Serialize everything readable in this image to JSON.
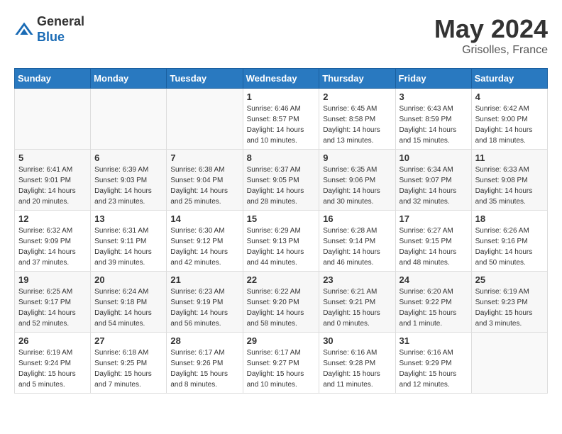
{
  "header": {
    "logo_general": "General",
    "logo_blue": "Blue",
    "title": "May 2024",
    "location": "Grisolles, France"
  },
  "calendar": {
    "weekdays": [
      "Sunday",
      "Monday",
      "Tuesday",
      "Wednesday",
      "Thursday",
      "Friday",
      "Saturday"
    ],
    "weeks": [
      [
        {
          "day": "",
          "sunrise": "",
          "sunset": "",
          "daylight": ""
        },
        {
          "day": "",
          "sunrise": "",
          "sunset": "",
          "daylight": ""
        },
        {
          "day": "",
          "sunrise": "",
          "sunset": "",
          "daylight": ""
        },
        {
          "day": "1",
          "sunrise": "6:46 AM",
          "sunset": "8:57 PM",
          "daylight": "14 hours and 10 minutes."
        },
        {
          "day": "2",
          "sunrise": "6:45 AM",
          "sunset": "8:58 PM",
          "daylight": "14 hours and 13 minutes."
        },
        {
          "day": "3",
          "sunrise": "6:43 AM",
          "sunset": "8:59 PM",
          "daylight": "14 hours and 15 minutes."
        },
        {
          "day": "4",
          "sunrise": "6:42 AM",
          "sunset": "9:00 PM",
          "daylight": "14 hours and 18 minutes."
        }
      ],
      [
        {
          "day": "5",
          "sunrise": "6:41 AM",
          "sunset": "9:01 PM",
          "daylight": "14 hours and 20 minutes."
        },
        {
          "day": "6",
          "sunrise": "6:39 AM",
          "sunset": "9:03 PM",
          "daylight": "14 hours and 23 minutes."
        },
        {
          "day": "7",
          "sunrise": "6:38 AM",
          "sunset": "9:04 PM",
          "daylight": "14 hours and 25 minutes."
        },
        {
          "day": "8",
          "sunrise": "6:37 AM",
          "sunset": "9:05 PM",
          "daylight": "14 hours and 28 minutes."
        },
        {
          "day": "9",
          "sunrise": "6:35 AM",
          "sunset": "9:06 PM",
          "daylight": "14 hours and 30 minutes."
        },
        {
          "day": "10",
          "sunrise": "6:34 AM",
          "sunset": "9:07 PM",
          "daylight": "14 hours and 32 minutes."
        },
        {
          "day": "11",
          "sunrise": "6:33 AM",
          "sunset": "9:08 PM",
          "daylight": "14 hours and 35 minutes."
        }
      ],
      [
        {
          "day": "12",
          "sunrise": "6:32 AM",
          "sunset": "9:09 PM",
          "daylight": "14 hours and 37 minutes."
        },
        {
          "day": "13",
          "sunrise": "6:31 AM",
          "sunset": "9:11 PM",
          "daylight": "14 hours and 39 minutes."
        },
        {
          "day": "14",
          "sunrise": "6:30 AM",
          "sunset": "9:12 PM",
          "daylight": "14 hours and 42 minutes."
        },
        {
          "day": "15",
          "sunrise": "6:29 AM",
          "sunset": "9:13 PM",
          "daylight": "14 hours and 44 minutes."
        },
        {
          "day": "16",
          "sunrise": "6:28 AM",
          "sunset": "9:14 PM",
          "daylight": "14 hours and 46 minutes."
        },
        {
          "day": "17",
          "sunrise": "6:27 AM",
          "sunset": "9:15 PM",
          "daylight": "14 hours and 48 minutes."
        },
        {
          "day": "18",
          "sunrise": "6:26 AM",
          "sunset": "9:16 PM",
          "daylight": "14 hours and 50 minutes."
        }
      ],
      [
        {
          "day": "19",
          "sunrise": "6:25 AM",
          "sunset": "9:17 PM",
          "daylight": "14 hours and 52 minutes."
        },
        {
          "day": "20",
          "sunrise": "6:24 AM",
          "sunset": "9:18 PM",
          "daylight": "14 hours and 54 minutes."
        },
        {
          "day": "21",
          "sunrise": "6:23 AM",
          "sunset": "9:19 PM",
          "daylight": "14 hours and 56 minutes."
        },
        {
          "day": "22",
          "sunrise": "6:22 AM",
          "sunset": "9:20 PM",
          "daylight": "14 hours and 58 minutes."
        },
        {
          "day": "23",
          "sunrise": "6:21 AM",
          "sunset": "9:21 PM",
          "daylight": "15 hours and 0 minutes."
        },
        {
          "day": "24",
          "sunrise": "6:20 AM",
          "sunset": "9:22 PM",
          "daylight": "15 hours and 1 minute."
        },
        {
          "day": "25",
          "sunrise": "6:19 AM",
          "sunset": "9:23 PM",
          "daylight": "15 hours and 3 minutes."
        }
      ],
      [
        {
          "day": "26",
          "sunrise": "6:19 AM",
          "sunset": "9:24 PM",
          "daylight": "15 hours and 5 minutes."
        },
        {
          "day": "27",
          "sunrise": "6:18 AM",
          "sunset": "9:25 PM",
          "daylight": "15 hours and 7 minutes."
        },
        {
          "day": "28",
          "sunrise": "6:17 AM",
          "sunset": "9:26 PM",
          "daylight": "15 hours and 8 minutes."
        },
        {
          "day": "29",
          "sunrise": "6:17 AM",
          "sunset": "9:27 PM",
          "daylight": "15 hours and 10 minutes."
        },
        {
          "day": "30",
          "sunrise": "6:16 AM",
          "sunset": "9:28 PM",
          "daylight": "15 hours and 11 minutes."
        },
        {
          "day": "31",
          "sunrise": "6:16 AM",
          "sunset": "9:29 PM",
          "daylight": "15 hours and 12 minutes."
        },
        {
          "day": "",
          "sunrise": "",
          "sunset": "",
          "daylight": ""
        }
      ]
    ]
  }
}
